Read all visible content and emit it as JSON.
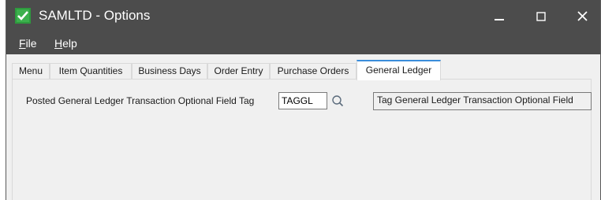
{
  "window": {
    "title": "SAMLTD - Options",
    "controls": {
      "minimize": "–",
      "maximize": "☐",
      "close": "✕"
    }
  },
  "menubar": {
    "items": [
      {
        "label": "File",
        "accel": "F",
        "rest": "ile"
      },
      {
        "label": "Help",
        "accel": "H",
        "rest": "elp"
      }
    ]
  },
  "tabs": [
    {
      "label": "Menu",
      "active": false
    },
    {
      "label": "Item Quantities",
      "active": false
    },
    {
      "label": "Business Days",
      "active": false
    },
    {
      "label": "Order Entry",
      "active": false
    },
    {
      "label": "Purchase Orders",
      "active": false
    },
    {
      "label": "General Ledger",
      "active": true
    }
  ],
  "general_ledger": {
    "field_label": "Posted General Ledger Transaction Optional Field Tag",
    "field_value": "TAGGL",
    "description": "Tag General Ledger Transaction Optional Field"
  },
  "icons": {
    "app": "sage-checkmark-icon",
    "finder": "magnifier-icon"
  },
  "colors": {
    "titlebar": "#4c4c4c",
    "app_icon": "#2e9b3e",
    "active_tab_border": "#3a8ddb"
  }
}
